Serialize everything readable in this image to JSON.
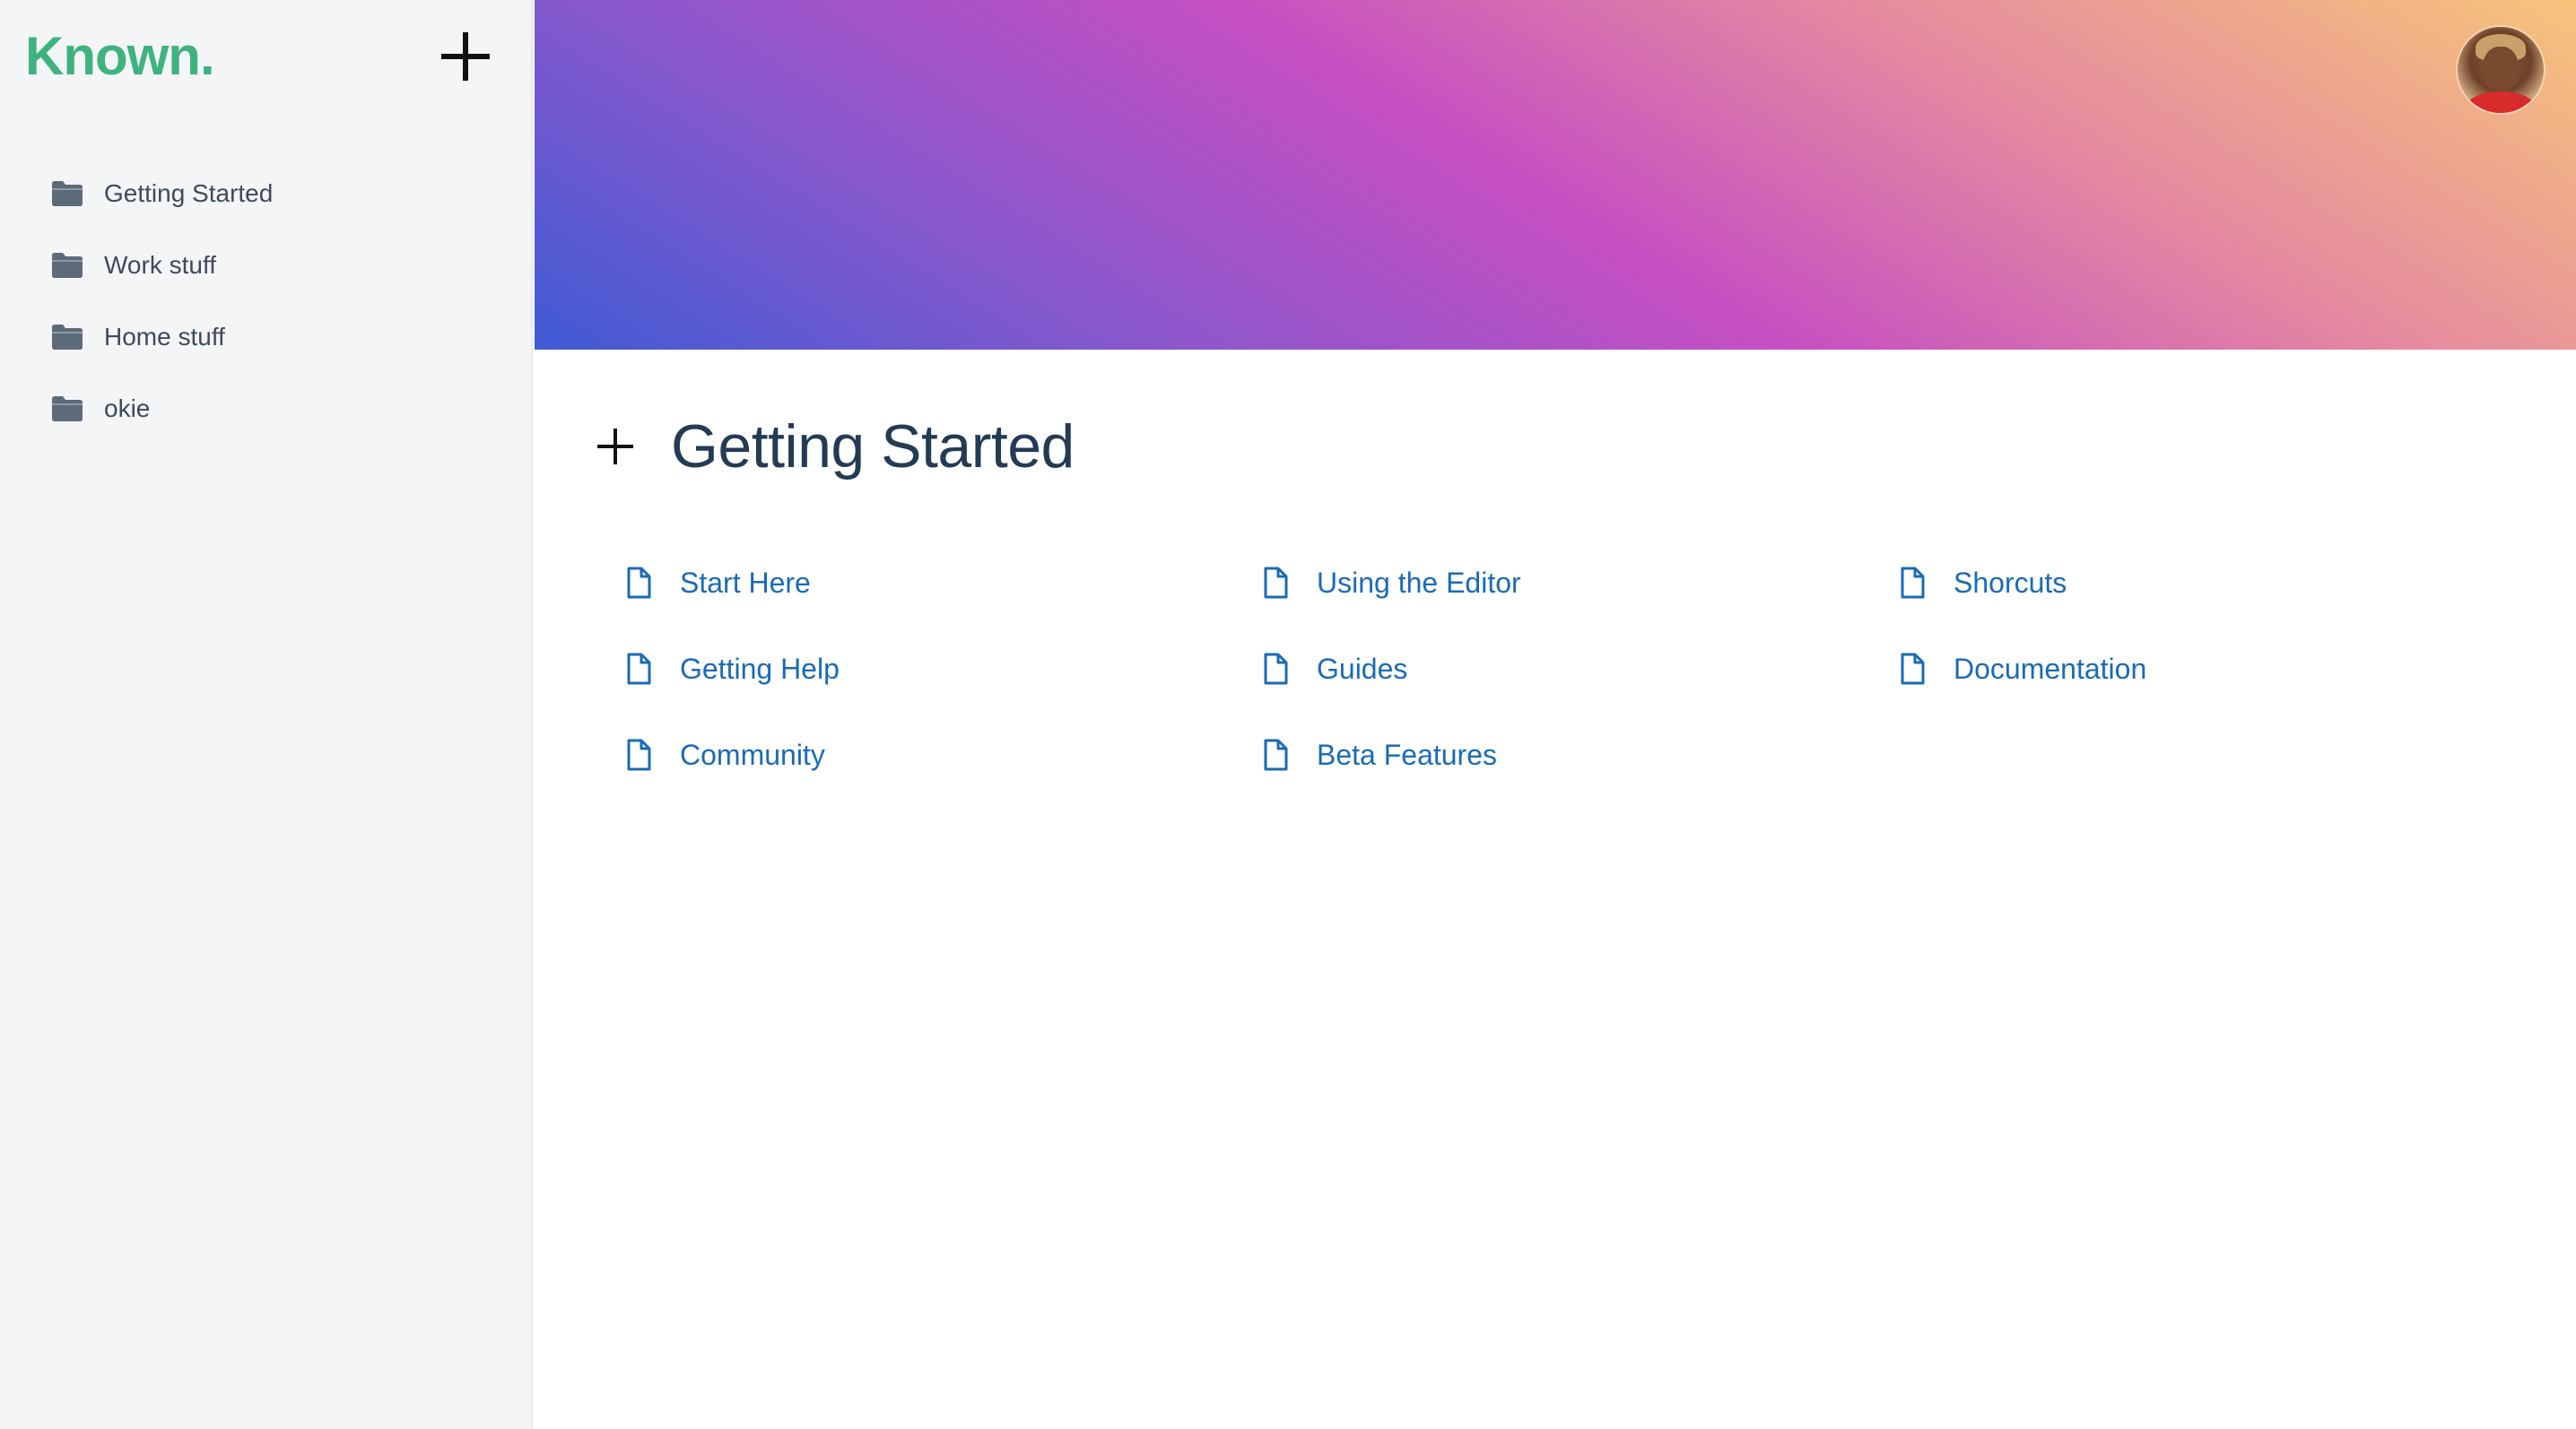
{
  "app": {
    "logo": "Known.",
    "brand_color": "#3fb37f",
    "link_color": "#1a6bb5"
  },
  "sidebar": {
    "add_icon": "plus-icon",
    "folders": [
      {
        "label": "Getting Started",
        "icon": "folder-icon"
      },
      {
        "label": "Work stuff",
        "icon": "folder-icon"
      },
      {
        "label": "Home stuff",
        "icon": "folder-icon"
      },
      {
        "label": "okie",
        "icon": "folder-icon"
      }
    ]
  },
  "header": {
    "avatar": "user-avatar"
  },
  "main": {
    "title": "Getting Started",
    "add_icon": "plus-icon",
    "documents": [
      {
        "label": "Start Here",
        "icon": "document-icon"
      },
      {
        "label": "Getting Help",
        "icon": "document-icon"
      },
      {
        "label": "Community",
        "icon": "document-icon"
      },
      {
        "label": "Using the Editor",
        "icon": "document-icon"
      },
      {
        "label": "Guides",
        "icon": "document-icon"
      },
      {
        "label": "Beta Features",
        "icon": "document-icon"
      },
      {
        "label": "Shorcuts",
        "icon": "document-icon"
      },
      {
        "label": "Documentation",
        "icon": "document-icon"
      }
    ]
  }
}
